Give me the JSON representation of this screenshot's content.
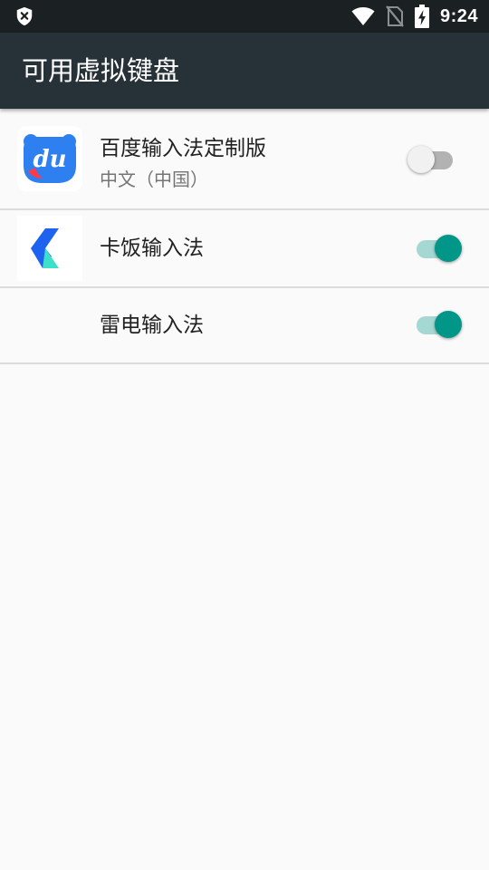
{
  "status_bar": {
    "time": "9:24",
    "icons": [
      "shield-x-icon",
      "wifi-icon",
      "no-sim-icon",
      "battery-charging-icon"
    ]
  },
  "app_bar": {
    "title": "可用虚拟键盘"
  },
  "keyboards": [
    {
      "name": "百度输入法定制版",
      "subtitle": "中文（中国）",
      "icon": "baidu-du-icon",
      "enabled": false
    },
    {
      "name": "卡饭输入法",
      "icon": "kafan-k-icon",
      "enabled": true
    },
    {
      "name": "雷电输入法",
      "icon": "",
      "enabled": true
    }
  ],
  "colors": {
    "status_bar": "#1b2023",
    "app_bar": "#263238",
    "background": "#fafafa",
    "switch_on_thumb": "#009688",
    "switch_on_track": "#a6d8d3",
    "switch_off_thumb": "#f1f1f1",
    "switch_off_track": "#b2b2b2",
    "baidu_blue": "#2e7ff0",
    "kafan_blue": "#1e63f0",
    "kafan_teal": "#3de0c8"
  }
}
